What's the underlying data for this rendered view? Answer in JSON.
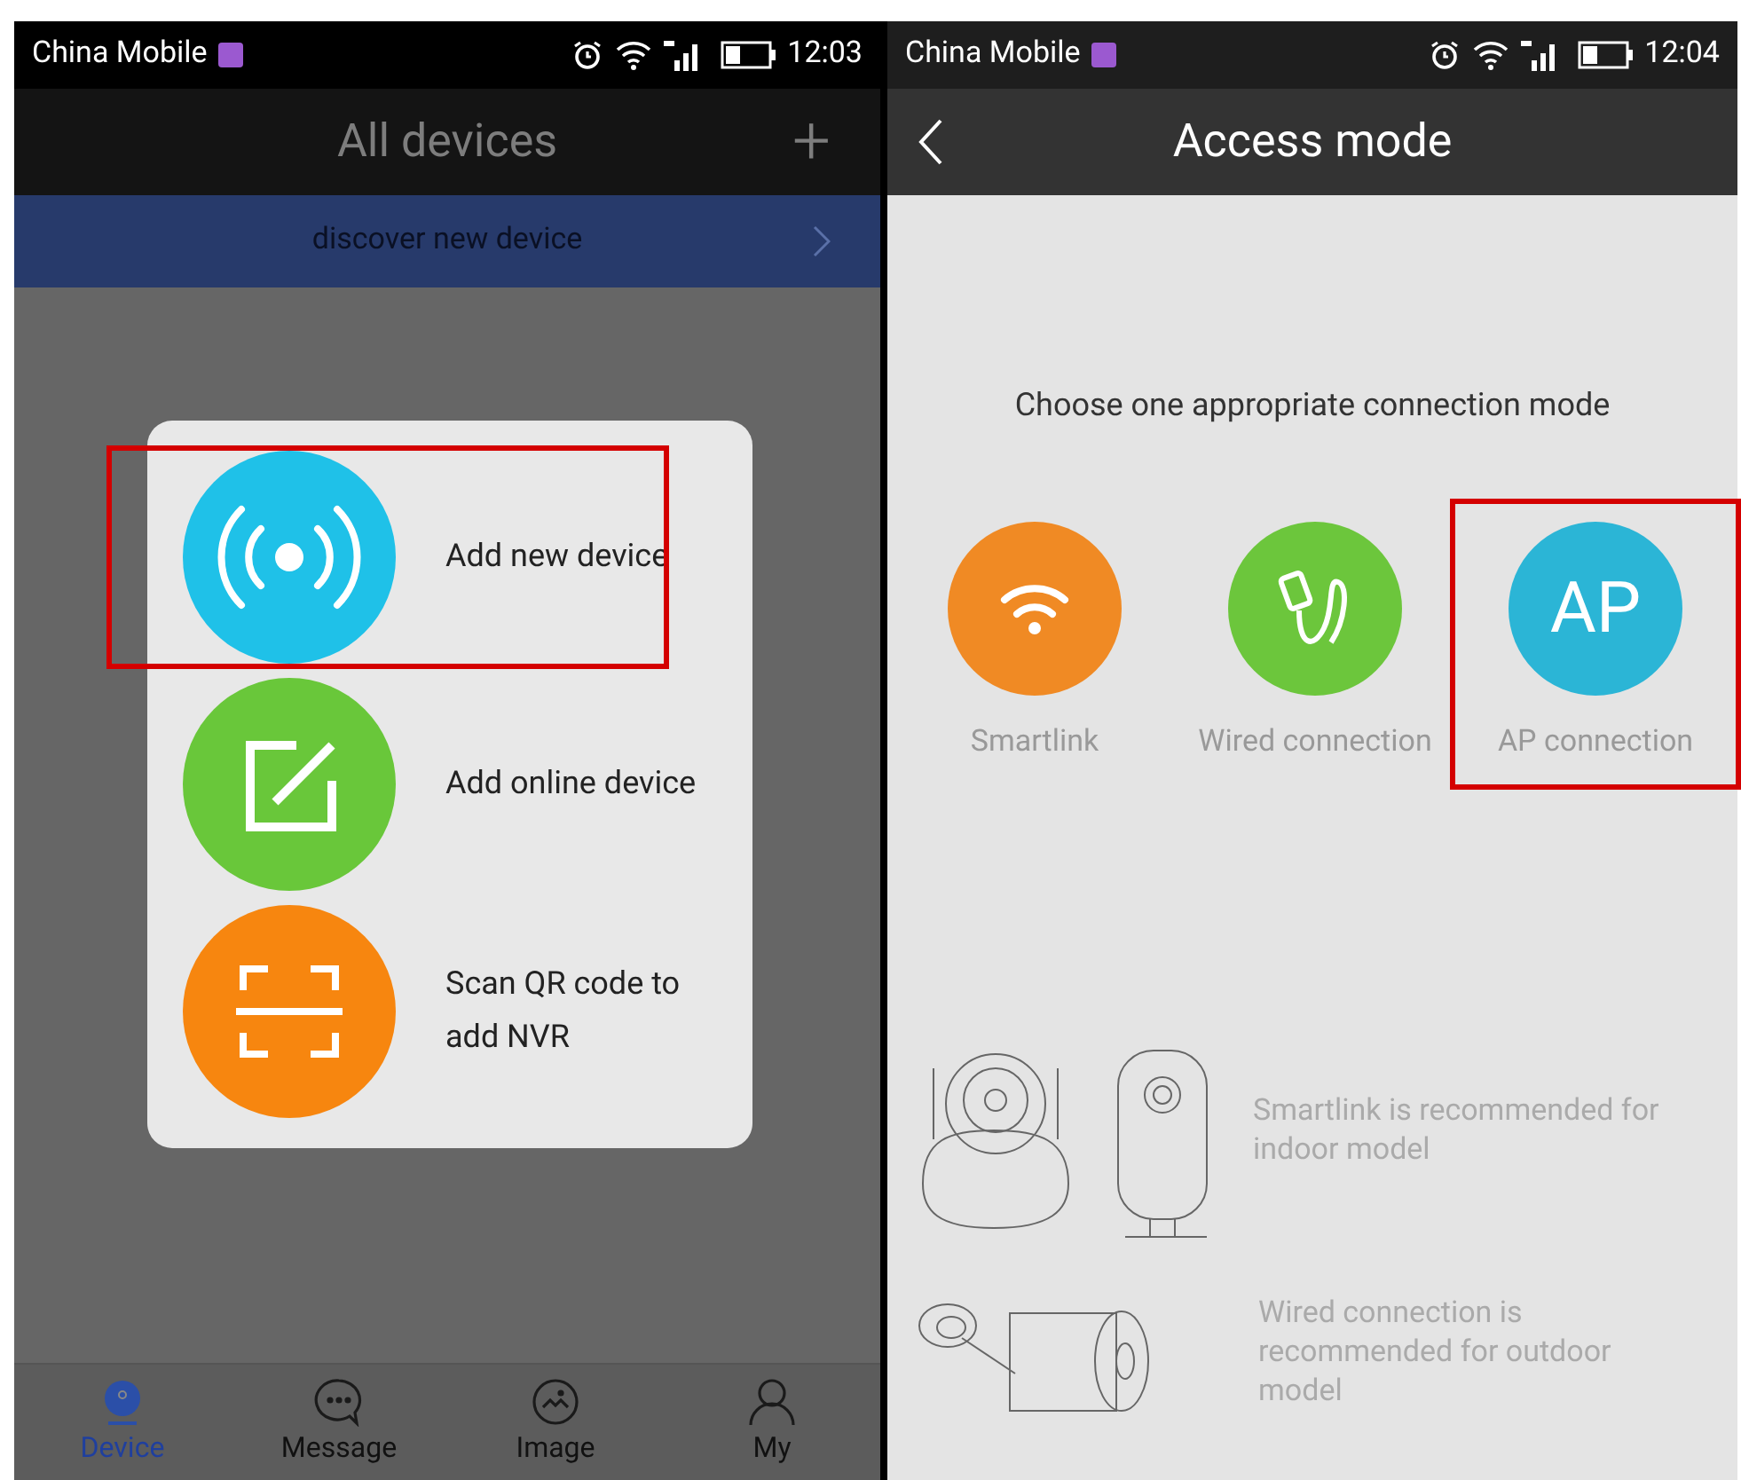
{
  "left_screen": {
    "status_bar": {
      "carrier": "China Mobile",
      "time": "12:03"
    },
    "header": {
      "title": "All devices",
      "action": "+"
    },
    "banner": {
      "text": "discover new device"
    },
    "popup": {
      "items": [
        {
          "kind": "broadcast",
          "label": "Add new device",
          "highlighted": true
        },
        {
          "kind": "edit",
          "label": "Add online device",
          "highlighted": false
        },
        {
          "kind": "scan",
          "label": "Scan QR code to add NVR",
          "highlighted": false
        }
      ]
    },
    "tab_bar": [
      {
        "kind": "device",
        "label": "Device",
        "selected": true
      },
      {
        "kind": "message",
        "label": "Message",
        "selected": false
      },
      {
        "kind": "image",
        "label": "Image",
        "selected": false
      },
      {
        "kind": "user",
        "label": "My",
        "selected": false
      }
    ]
  },
  "right_screen": {
    "status_bar": {
      "carrier": "China Mobile",
      "time": "12:04"
    },
    "header": {
      "title": "Access mode"
    },
    "prompt": "Choose one appropriate connection mode",
    "modes": [
      {
        "kind": "wifi",
        "label": "Smartlink",
        "color": "#f08a24",
        "highlighted": false
      },
      {
        "kind": "wired",
        "label": "Wired connection",
        "color": "#6cc63c",
        "highlighted": false
      },
      {
        "kind": "ap",
        "label": "AP connection",
        "icon_text": "AP",
        "color": "#2bb5d6",
        "highlighted": true
      }
    ],
    "recommendations": [
      {
        "kind": "indoor",
        "text": "Smartlink is recommended for indoor model"
      },
      {
        "kind": "outdoor",
        "text": "Wired connection is recommended for outdoor model"
      }
    ]
  }
}
